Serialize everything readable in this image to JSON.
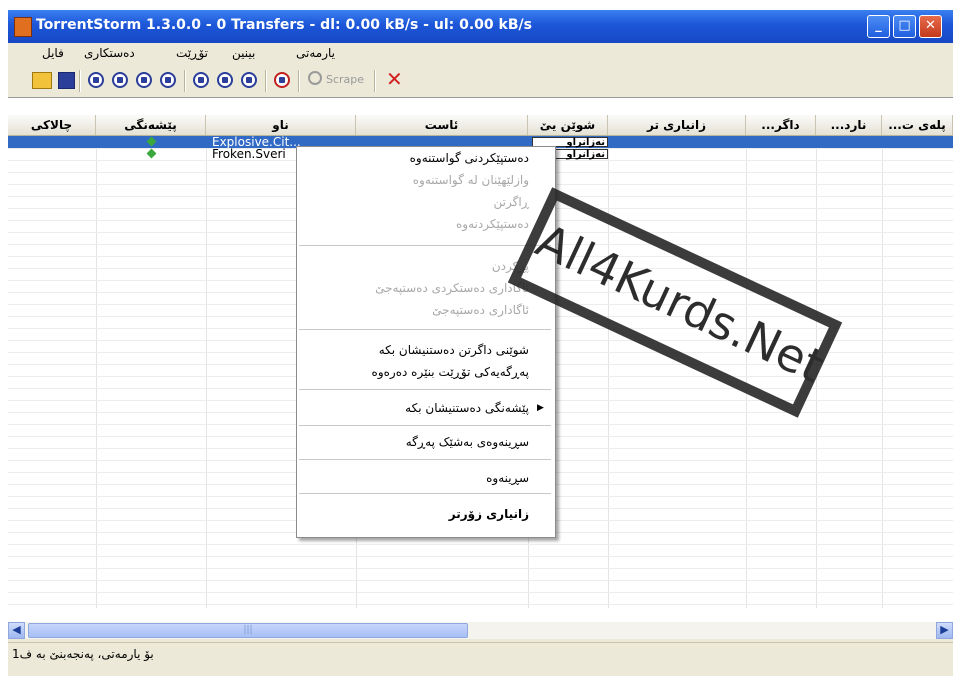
{
  "window": {
    "title": "TorrentStorm 1.3.0.0 - 0 Transfers - dl: 0.00 kB/s - ul: 0.00 kB/s"
  },
  "menubar": {
    "items": [
      "فایل",
      "دەستکاری",
      "تۆڕێت",
      "بینین",
      "یارمەتی"
    ]
  },
  "toolbar": {
    "scrape_label": "Scrape"
  },
  "table": {
    "columns": [
      "چالاکی",
      "پێشەنگی",
      "ناو",
      "ئاست",
      "شوێن یێ",
      "زانیاری تر",
      "...داگر",
      "...نارد",
      "...پلەی ت"
    ],
    "rows": [
      {
        "name": "Explosive.Cit...",
        "progress": "نەزانراو",
        "selected": true
      },
      {
        "name": "Froken.Sveri",
        "progress": "نەزانراو",
        "selected": false
      }
    ]
  },
  "context_menu": {
    "items": [
      {
        "label": "دەستپێکردنی گواستنەوە",
        "enabled": true
      },
      {
        "label": "وازلێهێنان لە گواستنەوە",
        "enabled": false
      },
      {
        "label": "ڕاگرتن",
        "enabled": false
      },
      {
        "label": "دەستپێکردنەوە",
        "enabled": false
      },
      {
        "label": "پڕکردن",
        "enabled": false
      },
      {
        "label": "ئاگاداری دەستکردی دەستپەجێ",
        "enabled": false
      },
      {
        "label": "ئاگاداری دەستپەجێ",
        "enabled": false
      },
      {
        "label": "شوێنی داگرتن دەستنیشان بکە",
        "enabled": true
      },
      {
        "label": "پەڕگەیەکی تۆڕێت بنێرە دەرەوە",
        "enabled": true
      },
      {
        "label": "پێشەنگی دەستنیشان بکە",
        "enabled": true
      },
      {
        "label": "سڕینەوەی بەشێک پەڕگە",
        "enabled": true
      },
      {
        "label": "سڕینەوە",
        "enabled": true
      },
      {
        "label": "زانیاری زۆرتر",
        "enabled": true
      }
    ]
  },
  "status": {
    "text": "بۆ یارمەتی، پەنجەبنێ بە ف1"
  },
  "watermark": {
    "text": "All4Kurds.Net"
  }
}
